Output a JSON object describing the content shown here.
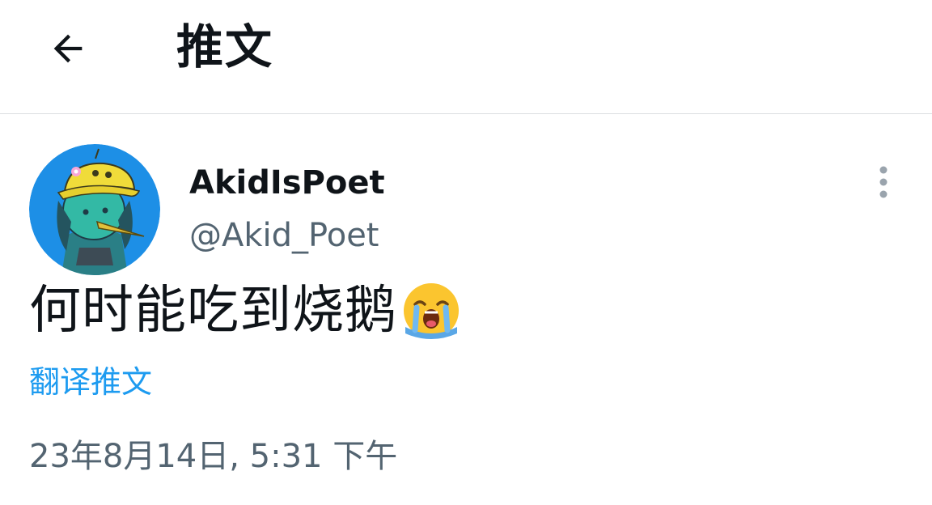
{
  "header": {
    "back_icon": "arrow-left-icon",
    "title": "推文"
  },
  "tweet": {
    "author": {
      "display_name": "AkidIsPoet",
      "handle": "@Akid_Poet",
      "avatar_colors": {
        "background": "#1d8fe6",
        "skin": "#33b9a5",
        "hat": "#f0dc3a"
      }
    },
    "more_icon": "more-vertical-icon",
    "text": "何时能吃到烧鹅",
    "emoji": "loudly-crying-face-icon",
    "translate_label": "翻译推文",
    "timestamp": "23年8月14日, 5:31 下午"
  },
  "colors": {
    "link": "#1d9bf0",
    "secondary_text": "#536471",
    "divider": "#dcdfe2"
  }
}
